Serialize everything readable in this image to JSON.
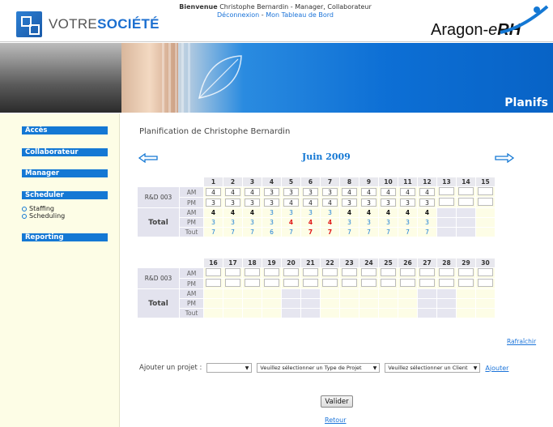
{
  "header": {
    "brand_left": "VOTRE",
    "brand_right": "SOCIÉTÉ",
    "welcome_bold": "Bienvenue",
    "welcome_text": " Christophe Bernardin - Manager, Collaborateur",
    "logout": "Déconnexion",
    "separator": " - ",
    "dashboard": "Mon Tableau de Bord",
    "product_a": "Aragon-",
    "product_e": "e",
    "product_rh": "RH"
  },
  "banner": {
    "section": "Planifs"
  },
  "sidebar": {
    "acces": "Accès",
    "collaborateur": "Collaborateur",
    "manager": "Manager",
    "scheduler": "Scheduler",
    "staffing": "Staffing",
    "scheduling": "Scheduling",
    "reporting": "Reporting"
  },
  "main": {
    "title": "Planification de Christophe Bernardin",
    "month": "Juin 2009",
    "project": "R&D 003",
    "total": "Total",
    "am": "AM",
    "pm": "PM",
    "tout": "Tout",
    "week1": {
      "days": [
        "1",
        "2",
        "3",
        "4",
        "5",
        "6",
        "7",
        "8",
        "9",
        "10",
        "11",
        "12",
        "13",
        "14",
        "15"
      ],
      "project_am": [
        "4",
        "4",
        "4",
        "3",
        "3",
        "3",
        "3",
        "4",
        "4",
        "4",
        "4",
        "4",
        "",
        "",
        ""
      ],
      "project_pm": [
        "3",
        "3",
        "3",
        "3",
        "4",
        "4",
        "4",
        "3",
        "3",
        "3",
        "3",
        "3",
        "",
        "",
        ""
      ],
      "total_am": [
        "4",
        "4",
        "4",
        "3",
        "3",
        "3",
        "3",
        "4",
        "4",
        "4",
        "4",
        "4",
        "",
        "",
        ""
      ],
      "total_pm": [
        "3",
        "3",
        "3",
        "3",
        "4",
        "4",
        "4",
        "3",
        "3",
        "3",
        "3",
        "3",
        "",
        "",
        ""
      ],
      "total_tout": [
        "7",
        "7",
        "7",
        "6",
        "7",
        "7",
        "7",
        "7",
        "7",
        "7",
        "7",
        "7",
        "",
        "",
        ""
      ]
    },
    "week2": {
      "days": [
        "16",
        "17",
        "18",
        "19",
        "20",
        "21",
        "22",
        "23",
        "24",
        "25",
        "26",
        "27",
        "28",
        "29",
        "30"
      ]
    },
    "refresh": "Rafraîchir",
    "add_label": "Ajouter un projet :",
    "select_project": "",
    "select_type": "Veuillez sélectionner un Type de Projet",
    "select_client": "Veuillez sélectionner un Client",
    "add_link": "Ajouter",
    "valider": "Valider",
    "retour": "Retour"
  },
  "colors": {
    "accent": "#1478d4",
    "sidebar_bg": "#fdfde6",
    "highlight_red": "#e01919"
  }
}
